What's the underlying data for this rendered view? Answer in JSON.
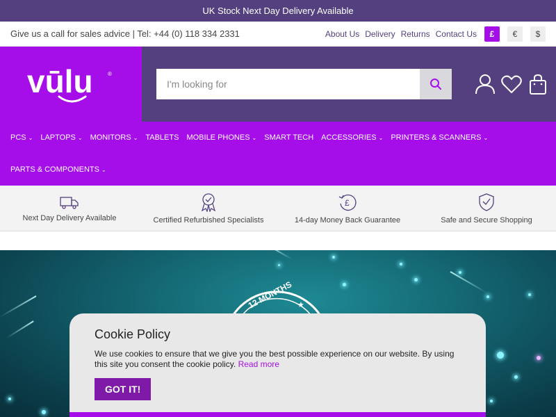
{
  "topbar": {
    "text": "UK Stock Next Day Delivery Available"
  },
  "infobar": {
    "phone_text": "Give us a call for sales advice | Tel: +44 (0) 118 334 2331",
    "links": [
      "About Us",
      "Delivery",
      "Returns",
      "Contact Us"
    ],
    "currencies": [
      "£",
      "€",
      "$"
    ],
    "active_currency": "£"
  },
  "header": {
    "logo_text": "vūlu",
    "logo_mark": "®",
    "search_placeholder": "I'm looking for",
    "icons": [
      "account-icon",
      "wishlist-icon",
      "basket-icon"
    ]
  },
  "nav": {
    "items": [
      {
        "label": "PCs",
        "has_dropdown": true
      },
      {
        "label": "LAPTOPS",
        "has_dropdown": true
      },
      {
        "label": "MONITORS",
        "has_dropdown": true
      },
      {
        "label": "TABLETS",
        "has_dropdown": false
      },
      {
        "label": "MOBILE PHONES",
        "has_dropdown": true
      },
      {
        "label": "SMART TECH",
        "has_dropdown": false
      },
      {
        "label": "ACCESSORIES",
        "has_dropdown": true
      },
      {
        "label": "PRINTERS & SCANNERS",
        "has_dropdown": true
      },
      {
        "label": "PARTS & COMPONENTS",
        "has_dropdown": true
      }
    ]
  },
  "usps": [
    {
      "label": "Next Day Delivery Available",
      "icon": "truck-icon"
    },
    {
      "label": "Certified Refurbished Specialists",
      "icon": "award-icon"
    },
    {
      "label": "14-day Money Back Guarantee",
      "icon": "refund-icon"
    },
    {
      "label": "Safe and Secure Shopping",
      "icon": "shield-icon"
    }
  ],
  "hero": {
    "badge_text": "12 MONTHS"
  },
  "cookie": {
    "title": "Cookie Policy",
    "body": "We use cookies to ensure that we give you the best possible experience on our website. By using this site you consent the cookie policy.",
    "link": "Read more",
    "button": "GOT IT!"
  },
  "colors": {
    "purple_dark": "#54407f",
    "purple_bright": "#a50ee8",
    "teal": "#136470"
  }
}
